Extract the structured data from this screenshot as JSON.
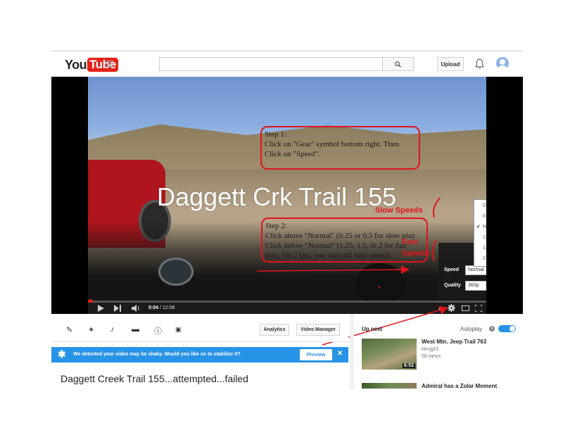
{
  "masthead": {
    "logo_you": "You",
    "logo_tube": "Tube",
    "upload_label": "Upload",
    "icons": [
      "guide-icon",
      "search-icon",
      "bell-icon",
      "avatar"
    ]
  },
  "player": {
    "video_title": "Daggett Crk Trail 155",
    "step1": {
      "line1": "Step 1:",
      "line2": "Click on \"Gear\" symbol bottom right. Then",
      "line3": "Click on \"Speed\"."
    },
    "step2": {
      "line1": "Step 2:",
      "line2": "Click above \"Normal\" (0.25 or 0.5 for slow play",
      "line3": "Click below \"Normal\" (1.25, 1.5, 0r 2 for fast",
      "line4": "play. On 2 fast, you can still hear speach."
    },
    "annotations": {
      "slow": "Slow Speeds",
      "fast_1": "Fast",
      "fast_2": "Speeds"
    },
    "speed_options": [
      "0.25",
      "0.5",
      "Normal",
      "1.25",
      "1.5",
      "2"
    ],
    "speed_selected": "Normal",
    "settings": {
      "speed_label": "Speed",
      "speed_value": "Normal",
      "quality_label": "Quality",
      "quality_value": "360p"
    },
    "current_time": "0:04",
    "duration": "12:08",
    "progress_fraction": 0.0055
  },
  "action_bar": {
    "analytics_label": "Analytics",
    "video_manager_label": "Video Manager",
    "icons": [
      "pencil-icon",
      "magic-wand-icon",
      "music-note-icon",
      "comment-icon",
      "info-icon",
      "cc-icon"
    ]
  },
  "stabilize": {
    "message": "We detected your video may be shaky. Would you like us to stabilize it?",
    "preview_label": "Preview",
    "close_label": "✕"
  },
  "watch_title": "Daggett Creek Trail 155...attempted...failed",
  "sidebar": {
    "up_next": "Up next",
    "autoplay_label": "Autoplay",
    "autoplay_on": true,
    "items": [
      {
        "title": "West Mtn. Jeep Trail 763",
        "channel": "klnrgj01",
        "views": "58 views",
        "duration": "6:52"
      },
      {
        "title": "Admiral has a Zolar Moment"
      }
    ]
  },
  "colors": {
    "youtube_red": "#e62117",
    "annotation_red": "#e0141c",
    "stabilize_blue": "#2793e6"
  }
}
